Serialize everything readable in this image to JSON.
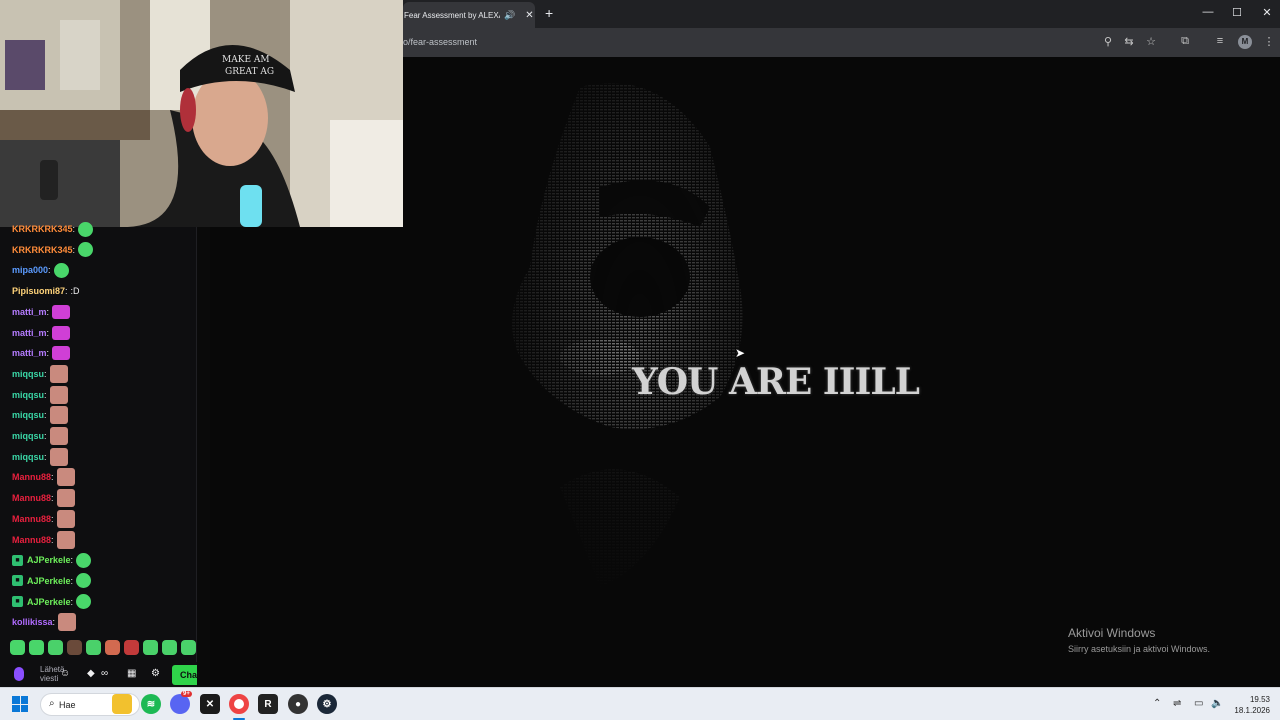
{
  "browser": {
    "tab_title": "Fear Assessment by ALEXAI",
    "url": "o/fear-assessment",
    "avatar_letter": "M"
  },
  "page": {
    "headline": "YOU ARE IIILL",
    "watermark_title": "Aktivoi Windows",
    "watermark_sub": "Siirry asetuksiin ja aktivoi Windows."
  },
  "webcam": {
    "cap_text_1": "MAKE AM",
    "cap_text_2": "GREAT AG"
  },
  "chat": {
    "messages": [
      {
        "user": "KRKRKRK345",
        "color": "#ff8c3a",
        "text": ""
      },
      {
        "user": "KRKRKRK345",
        "color": "#ff8c3a",
        "text": ""
      },
      {
        "user": "mipa000",
        "color": "#5b9bff",
        "text": ""
      },
      {
        "user": "Pipisuomi87",
        "color": "#ffd37a",
        "text": ":D"
      },
      {
        "user": "matti_m",
        "color": "#b57cff",
        "text": ""
      },
      {
        "user": "matti_m",
        "color": "#b57cff",
        "text": ""
      },
      {
        "user": "matti_m",
        "color": "#b57cff",
        "text": ""
      },
      {
        "user": "miqqsu",
        "color": "#3ad6a6",
        "text": ""
      },
      {
        "user": "miqqsu",
        "color": "#3ad6a6",
        "text": ""
      },
      {
        "user": "miqqsu",
        "color": "#3ad6a6",
        "text": ""
      },
      {
        "user": "miqqsu",
        "color": "#3ad6a6",
        "text": ""
      },
      {
        "user": "miqqsu",
        "color": "#3ad6a6",
        "text": ""
      },
      {
        "user": "Mannu88",
        "color": "#e8203e",
        "text": ""
      },
      {
        "user": "Mannu88",
        "color": "#e8203e",
        "text": ""
      },
      {
        "user": "Mannu88",
        "color": "#e8203e",
        "text": ""
      },
      {
        "user": "Mannu88",
        "color": "#e8203e",
        "text": ""
      },
      {
        "user": "AJPerkele",
        "color": "#6df05b",
        "text": ""
      },
      {
        "user": "AJPerkele",
        "color": "#6df05b",
        "text": ""
      },
      {
        "user": "AJPerkele",
        "color": "#6df05b",
        "text": ""
      },
      {
        "user": "kollikissa",
        "color": "#b06bff",
        "text": ""
      }
    ],
    "input_placeholder": "Lähetä viesti",
    "chat_button": "Chat"
  },
  "taskbar": {
    "search_label": "Hae",
    "time": "19.53",
    "date": "18.1.2026",
    "discord_badge": "9+"
  },
  "colors": {
    "accent": "#0a78d7",
    "chat_button": "#2fd34a"
  }
}
